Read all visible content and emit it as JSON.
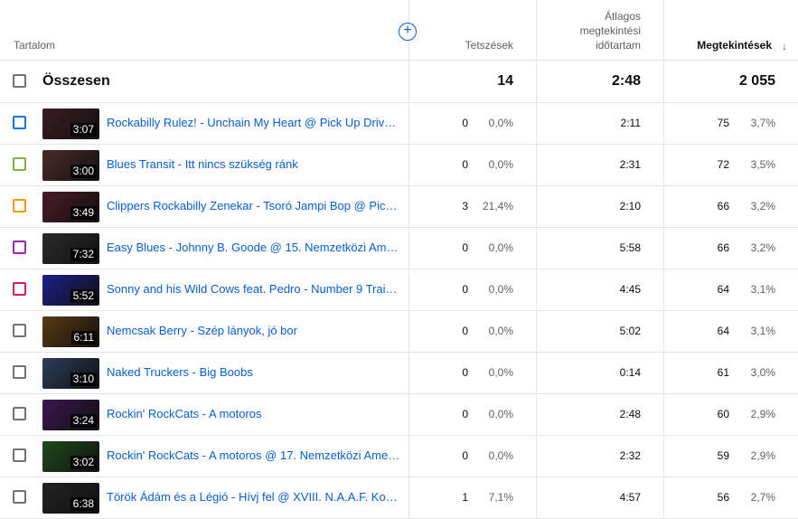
{
  "header": {
    "content": "Tartalom",
    "likes": "Tetszések",
    "avg_line1": "Átlagos",
    "avg_line2": "megtekintési",
    "avg_line3": "időtartam",
    "views": "Megtekintések",
    "sort_icon": "arrow-down-icon",
    "add_icon": "plus-circle-icon"
  },
  "total": {
    "label": "Összesen",
    "likes": "14",
    "avg": "2:48",
    "views": "2 055"
  },
  "rows": [
    {
      "color": "#1a73e8",
      "duration": "3:07",
      "title": "Rockabilly Rulez! - Unchain My Heart @ Pick Up Drive R...",
      "likes": "0",
      "likes_pct": "0,0%",
      "avg": "2:11",
      "views": "75",
      "views_pct": "3,7%",
      "thumb": "#3b1d22"
    },
    {
      "color": "#7cb342",
      "duration": "3:00",
      "title": "Blues Transit - Itt nincs szükség ránk",
      "likes": "0",
      "likes_pct": "0,0%",
      "avg": "2:31",
      "views": "72",
      "views_pct": "3,5%",
      "thumb": "#4a2a2a"
    },
    {
      "color": "#f29900",
      "duration": "3:49",
      "title": "Clippers Rockabilly Zenekar - Tsoró Jampi Bop @ Pick ...",
      "likes": "3",
      "likes_pct": "21,4%",
      "avg": "2:10",
      "views": "66",
      "views_pct": "3,2%",
      "thumb": "#4b1a24"
    },
    {
      "color": "#9c27b0",
      "duration": "7:32",
      "title": "Easy Blues - Johnny B. Goode @ 15. Nemzetközi Ameri...",
      "likes": "0",
      "likes_pct": "0,0%",
      "avg": "5:58",
      "views": "66",
      "views_pct": "3,2%",
      "thumb": "#2a2a2a"
    },
    {
      "color": "#d81b60",
      "duration": "5:52",
      "title": "Sonny and his Wild Cows feat. Pedro - Number 9 Train ...",
      "likes": "0",
      "likes_pct": "0,0%",
      "avg": "4:45",
      "views": "64",
      "views_pct": "3,1%",
      "thumb": "#1b1f8a"
    },
    {
      "color": "#737373",
      "duration": "6:11",
      "title": "Nemcsak Berry - Szép lányok, jó bor",
      "likes": "0",
      "likes_pct": "0,0%",
      "avg": "5:02",
      "views": "64",
      "views_pct": "3,1%",
      "thumb": "#5a3a10"
    },
    {
      "color": "#737373",
      "duration": "3:10",
      "title": "Naked Truckers - Big Boobs",
      "likes": "0",
      "likes_pct": "0,0%",
      "avg": "0:14",
      "views": "61",
      "views_pct": "3,0%",
      "thumb": "#2c3e5a"
    },
    {
      "color": "#737373",
      "duration": "3:24",
      "title": "Rockin' RockCats - A motoros",
      "likes": "0",
      "likes_pct": "0,0%",
      "avg": "2:48",
      "views": "60",
      "views_pct": "2,9%",
      "thumb": "#3a1650"
    },
    {
      "color": "#737373",
      "duration": "3:02",
      "title": "Rockin' RockCats - A motoros @ 17. Nemzetközi Ameri...",
      "likes": "0",
      "likes_pct": "0,0%",
      "avg": "2:32",
      "views": "59",
      "views_pct": "2,9%",
      "thumb": "#1f4a1a"
    },
    {
      "color": "#737373",
      "duration": "6:38",
      "title": "Török Ádám és a Légió - Hívj fel @ XVIII. N.A.A.F. Kom...",
      "likes": "1",
      "likes_pct": "7,1%",
      "avg": "4:57",
      "views": "56",
      "views_pct": "2,7%",
      "thumb": "#222222"
    }
  ]
}
